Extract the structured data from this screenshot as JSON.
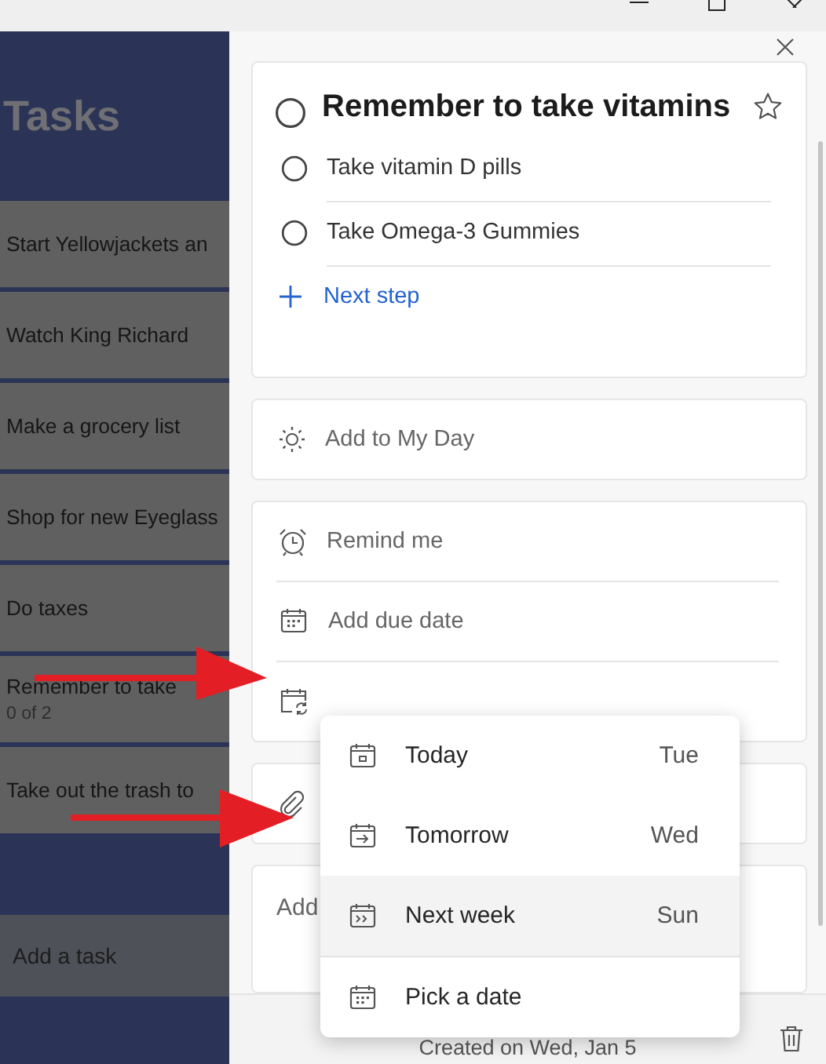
{
  "task_list": {
    "title": "Tasks",
    "tasks": [
      {
        "title": "Start Yellowjackets an"
      },
      {
        "title": "Watch King Richard"
      },
      {
        "title": "Make a grocery list"
      },
      {
        "title": "Shop for new Eyeglass"
      },
      {
        "title": "Do taxes"
      },
      {
        "title": "Remember to take",
        "meta": "0 of 2"
      },
      {
        "title": "Take out the trash to"
      }
    ],
    "add_task": "Add a task"
  },
  "detail": {
    "title": "Remember to take vitamins",
    "completed": false,
    "important": false,
    "steps": [
      {
        "label": "Take vitamin D pills",
        "completed": false
      },
      {
        "label": "Take Omega-3 Gummies",
        "completed": false
      }
    ],
    "next_step": "Next step",
    "my_day": "Add to My Day",
    "remind": "Remind me",
    "due": "Add due date",
    "note": "Add",
    "created": "Created on Wed, Jan 5"
  },
  "due_menu": {
    "items": [
      {
        "kind": "today",
        "label": "Today",
        "day": "Tue",
        "highlighted": false
      },
      {
        "kind": "tomorrow",
        "label": "Tomorrow",
        "day": "Wed",
        "highlighted": false
      },
      {
        "kind": "next_week",
        "label": "Next week",
        "day": "Sun",
        "highlighted": true
      },
      {
        "kind": "pick",
        "label": "Pick a date",
        "highlighted": false
      }
    ]
  }
}
